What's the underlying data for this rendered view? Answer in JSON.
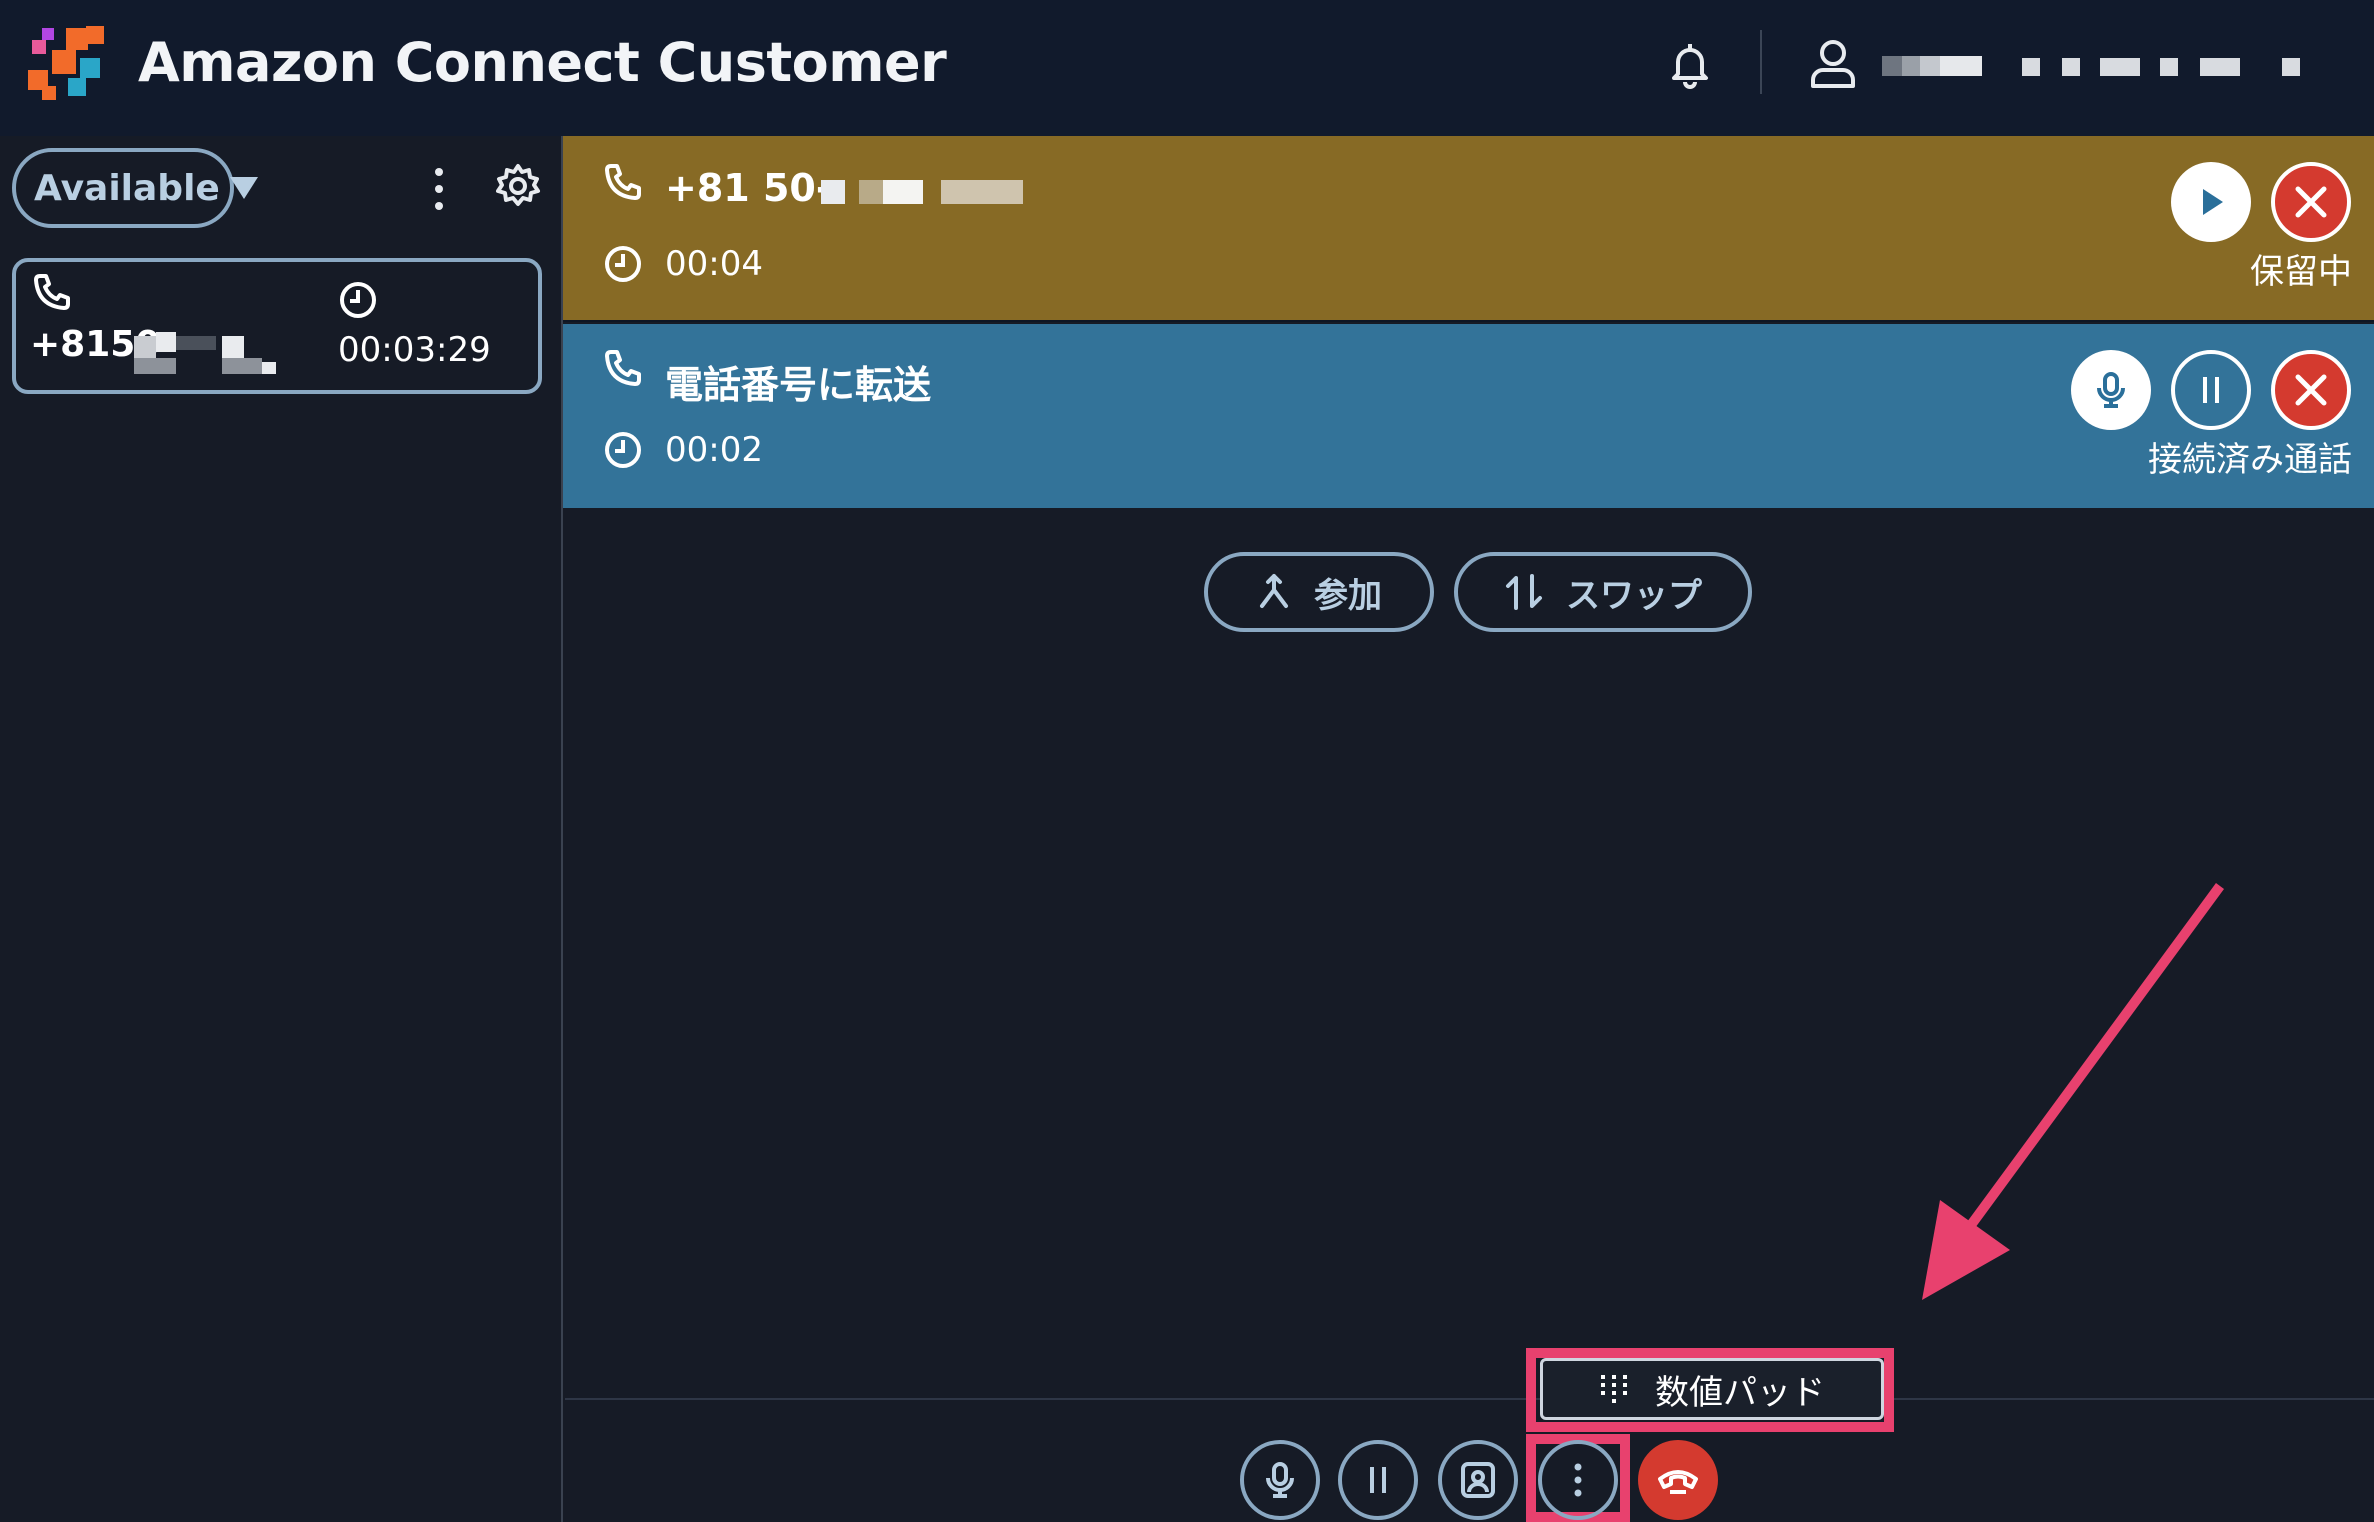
{
  "header": {
    "title": "Amazon Connect Customer",
    "icons": [
      "logo-icon",
      "bell-icon",
      "user-icon"
    ]
  },
  "sidebar": {
    "status_label": "Available",
    "contact": {
      "number": "+8150",
      "timer": "00:03:29"
    }
  },
  "calls": [
    {
      "number": "+81 50-",
      "time": "00:04",
      "status": "保留中",
      "color": "#876a25"
    },
    {
      "title": "電話番号に転送",
      "time": "00:02",
      "status": "接続済み通話",
      "color": "#337399"
    }
  ],
  "actions": {
    "join_label": "参加",
    "swap_label": "スワップ"
  },
  "popup": {
    "numpad_label": "数値パッド"
  },
  "colors": {
    "accent": "#8aa8c2",
    "danger": "#d43a2f",
    "highlight": "#e8416e"
  }
}
